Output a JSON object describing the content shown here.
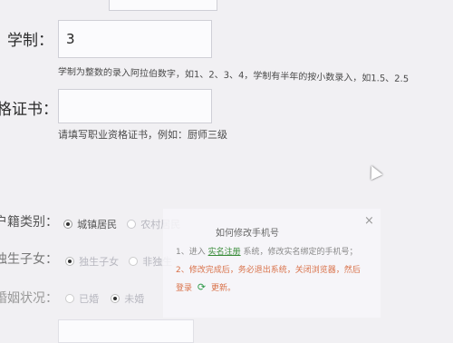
{
  "form": {
    "schooling": {
      "label": "学制：",
      "value": "3",
      "hint": "学制为整数的录入阿拉伯数字，如1、2、3、4，学制有半年的按小数录入，如1.5、2.5"
    },
    "certificate": {
      "label": "格证书：",
      "value": "",
      "hint": "请填写职业资格证书，例如：厨师三级"
    },
    "household": {
      "label": "户籍类别：",
      "options": [
        "城镇居民",
        "农村居民"
      ],
      "selected": "城镇居民"
    },
    "only_child": {
      "label": "独生子女：",
      "options": [
        "独生子女",
        "非独生"
      ],
      "selected": "独生子女"
    },
    "marital": {
      "label": "婚姻状况：",
      "options": [
        "已婚",
        "未婚"
      ],
      "selected": "未婚"
    }
  },
  "popup": {
    "title": "如何修改手机号",
    "close": "×",
    "step1_prefix": "1、进入",
    "step1_link": "实名注册",
    "step1_suffix": "系统，修改实名绑定的手机号；",
    "step2": "2、修改完成后，务必退出系统，关闭浏览器，然后",
    "refresh_prefix": "登录",
    "refresh_label": "更新。"
  },
  "colors": {
    "link": "#3a8c3a",
    "warning": "#d9724a",
    "refresh": "#2f9a4a"
  },
  "icons": [
    "refresh-icon",
    "close-icon",
    "mouse-cursor-icon"
  ]
}
